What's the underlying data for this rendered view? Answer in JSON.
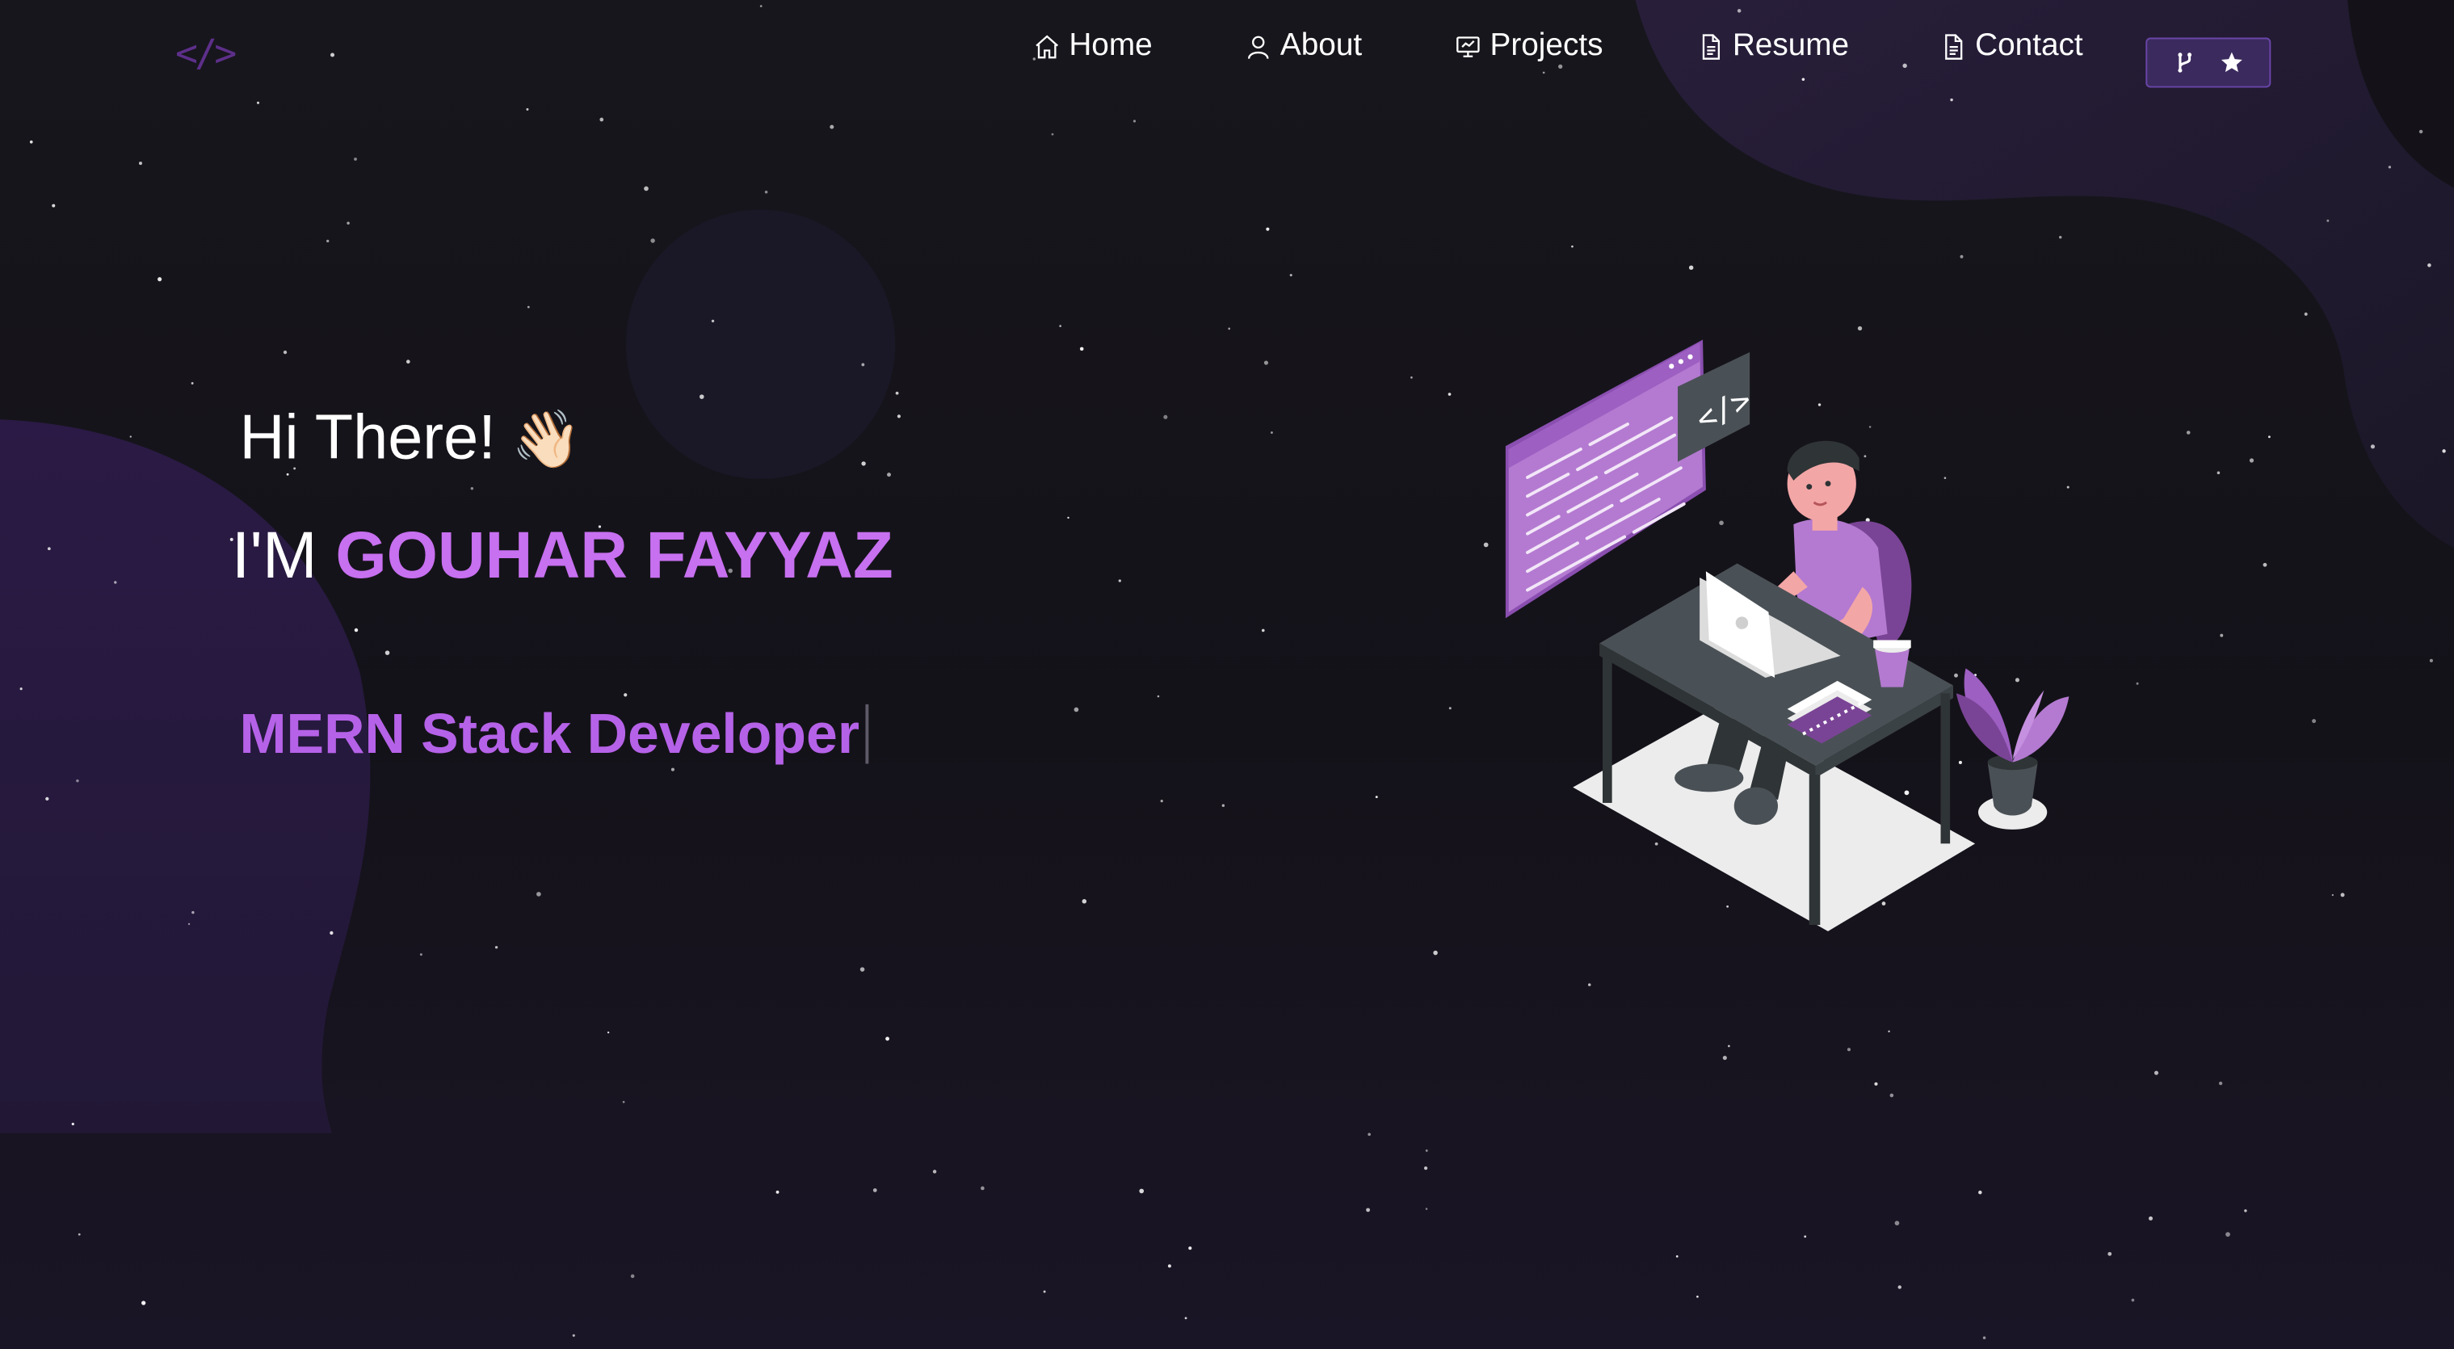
{
  "logo": {
    "text": "</>"
  },
  "nav": {
    "items": [
      {
        "label": "Home",
        "icon": "home-icon"
      },
      {
        "label": "About",
        "icon": "user-icon"
      },
      {
        "label": "Projects",
        "icon": "projects-icon"
      },
      {
        "label": "Resume",
        "icon": "document-icon"
      },
      {
        "label": "Contact",
        "icon": "document-icon"
      }
    ],
    "github_button": {
      "icons": [
        "git-fork-icon",
        "star-icon"
      ]
    }
  },
  "hero": {
    "greeting": "Hi There!",
    "wave_emoji": "👋🏻",
    "intro_prefix": "I'M",
    "name": "GOUHAR FAYYAZ",
    "role": "MERN Stack Developer"
  },
  "colors": {
    "accent": "#c770f0",
    "role": "#b562e8",
    "background": "#15141b",
    "button_bg": "#3b2a5e"
  }
}
